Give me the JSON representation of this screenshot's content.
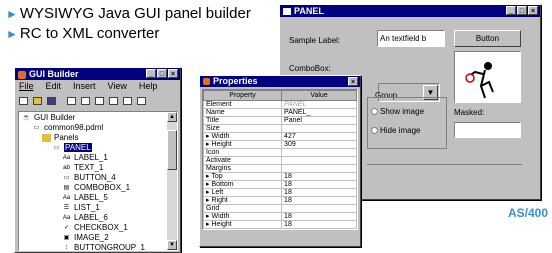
{
  "bullets": [
    "WYSIWYG Java GUI panel builder",
    "RC to XML converter"
  ],
  "panel": {
    "title": "PANEL",
    "sample_label": "Sample Label:",
    "textfield_value": "An textfield b",
    "button_label": "Button",
    "combo_label": "ComboBox:",
    "group_label": "Group",
    "radio_show": "Show image",
    "radio_hide": "Hide image",
    "masked_label": "Masked:"
  },
  "builder": {
    "title": "GUI Builder",
    "menu": [
      "File",
      "Edit",
      "Insert",
      "View",
      "Help"
    ],
    "tree": [
      {
        "label": "GUI Builder",
        "level": 0,
        "icon": "builder-icon"
      },
      {
        "label": "common98.pdml",
        "level": 1,
        "icon": "document-icon"
      },
      {
        "label": "Panels",
        "level": 2,
        "icon": "folder-icon"
      },
      {
        "label": "PANEL",
        "level": 3,
        "icon": "panel-icon",
        "selected": true
      },
      {
        "label": "LABEL_1",
        "level": 4,
        "icon": "label-icon"
      },
      {
        "label": "TEXT_1",
        "level": 4,
        "icon": "text-icon"
      },
      {
        "label": "BUTTON_4",
        "level": 4,
        "icon": "button-icon"
      },
      {
        "label": "COMBOBOX_1",
        "level": 4,
        "icon": "combobox-icon"
      },
      {
        "label": "LABEL_5",
        "level": 4,
        "icon": "label-icon"
      },
      {
        "label": "LIST_1",
        "level": 4,
        "icon": "list-icon"
      },
      {
        "label": "LABEL_6",
        "level": 4,
        "icon": "label-icon"
      },
      {
        "label": "CHECKBOX_1",
        "level": 4,
        "icon": "checkbox-icon"
      },
      {
        "label": "IMAGE_2",
        "level": 4,
        "icon": "image-icon"
      },
      {
        "label": "BUTTONGROUP_1",
        "level": 4,
        "icon": "buttongroup-icon"
      }
    ]
  },
  "properties": {
    "title": "Properties",
    "header": [
      "Property",
      "Value"
    ],
    "rows": [
      [
        "Element",
        "PANEL"
      ],
      [
        "Name",
        "PANEL_"
      ],
      [
        "Title",
        "Panel"
      ],
      [
        "Size",
        ""
      ],
      [
        "▸ Width",
        "427"
      ],
      [
        "▸ Height",
        "309"
      ],
      [
        "Icon",
        ""
      ],
      [
        "Activate",
        ""
      ],
      [
        "Margins",
        ""
      ],
      [
        "▸ Top",
        "18"
      ],
      [
        "▸ Bottom",
        "18"
      ],
      [
        "▸ Left",
        "18"
      ],
      [
        "▸ Right",
        "18"
      ],
      [
        "Grid",
        ""
      ],
      [
        "▸ Width",
        "18"
      ],
      [
        "▸ Height",
        "18"
      ]
    ]
  },
  "footer": "AS/400"
}
